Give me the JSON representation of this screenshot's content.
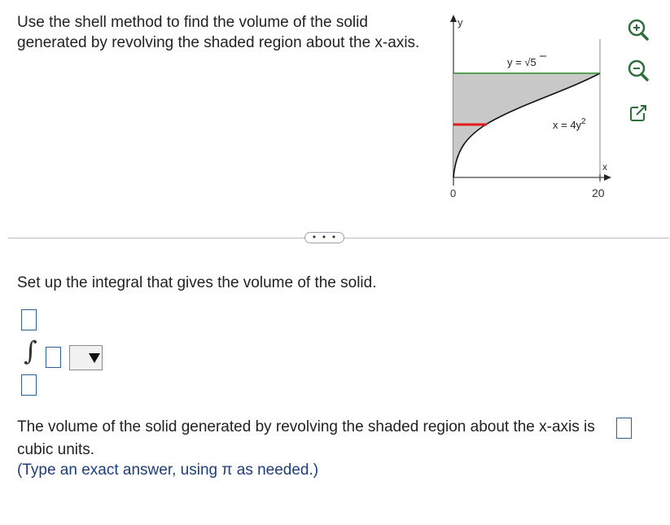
{
  "question": {
    "line1": "Use the shell method to find the volume of the solid",
    "line2": "generated by revolving the shaded region about the x-axis."
  },
  "graph": {
    "y_axis_label": "y",
    "x_axis_label": "x",
    "origin_label": "0",
    "x_tick_label": "20",
    "line_label_prefix": "y = ",
    "line_label_radicand": "5",
    "curve_label": "x = 4y",
    "curve_label_exponent": "2"
  },
  "tools": [
    "zoom-in-icon",
    "zoom-out-icon",
    "open-external-icon"
  ],
  "more_button_label": "• • •",
  "setup_prompt": "Set up the integral that gives the volume of the solid.",
  "volume_prompt": "The volume of the solid generated by revolving the shaded region about the x-axis is",
  "units_text": "cubic units.",
  "hint_text": "(Type an exact answer, using π as needed.)",
  "colors": {
    "accent": "#1c3e7a",
    "box_border": "#2f5f9a",
    "shade": "#c8c8c8",
    "line_green": "#2a8a2a",
    "strip_red": "#e31a1a"
  }
}
